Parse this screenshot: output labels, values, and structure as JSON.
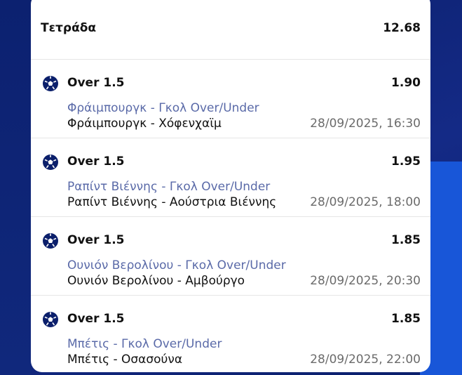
{
  "bet": {
    "type_label": "Τετράδα",
    "total_odds": "12.68"
  },
  "selections": [
    {
      "market": "Over 1.5",
      "odds": "1.90",
      "line": "Φράιμπουργκ - Γκολ Over/Under",
      "match": "Φράιμπουργκ - Χόφενχαϊμ",
      "datetime": "28/09/2025, 16:30"
    },
    {
      "market": "Over 1.5",
      "odds": "1.95",
      "line": "Ραπίντ Βιέννης - Γκολ Over/Under",
      "match": "Ραπίντ Βιέννης - Αούστρια Βιέννης",
      "datetime": "28/09/2025, 18:00"
    },
    {
      "market": "Over 1.5",
      "odds": "1.85",
      "line": "Ουνιόν Βερολίνου - Γκολ Over/Under",
      "match": "Ουνιόν Βερολίνου - Αμβούργο",
      "datetime": "28/09/2025, 20:30"
    },
    {
      "market": "Over 1.5",
      "odds": "1.85",
      "line": "Μπέτις - Γκολ Over/Under",
      "match": "Μπέτις - Οσασούνα",
      "datetime": "28/09/2025, 22:00"
    }
  ],
  "colors": {
    "background": "#0b1f6b",
    "accent_stripe": "#1856d8",
    "subline": "#5a6aa8",
    "datetime": "#6b6b6b"
  },
  "icons": {
    "sport": "soccer-ball-icon"
  }
}
